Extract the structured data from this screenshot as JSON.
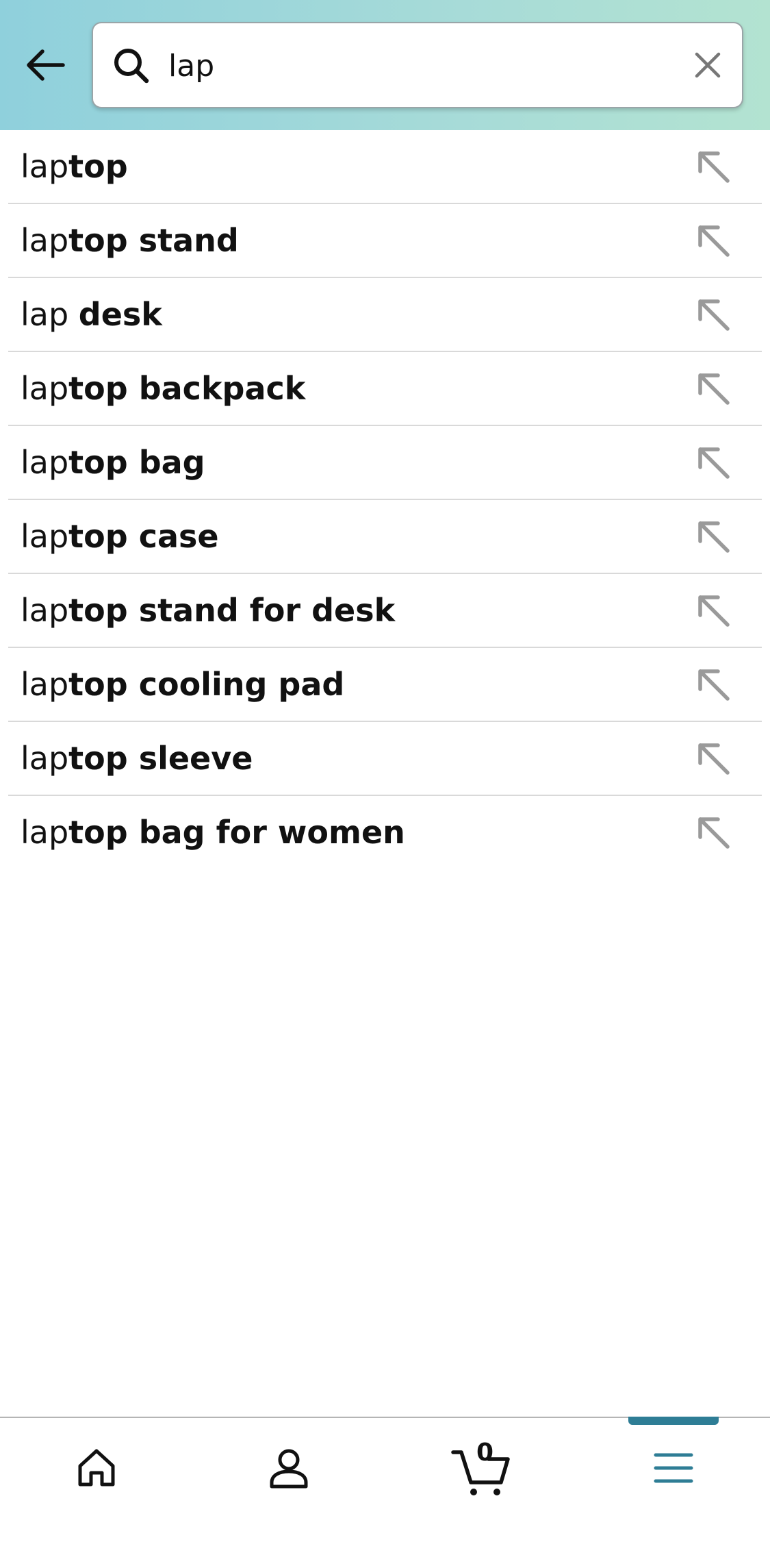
{
  "search": {
    "value": "lap",
    "placeholder": ""
  },
  "suggestions": [
    {
      "prefix": "lap",
      "completion": "top"
    },
    {
      "prefix": "lap",
      "completion": "top stand"
    },
    {
      "prefix": "lap ",
      "completion": "desk"
    },
    {
      "prefix": "lap",
      "completion": "top backpack"
    },
    {
      "prefix": "lap",
      "completion": "top bag"
    },
    {
      "prefix": "lap",
      "completion": "top case"
    },
    {
      "prefix": "lap",
      "completion": "top stand for desk"
    },
    {
      "prefix": "lap",
      "completion": "top cooling pad"
    },
    {
      "prefix": "lap",
      "completion": "top sleeve"
    },
    {
      "prefix": "lap",
      "completion": "top bag for women"
    }
  ],
  "bottom_nav": {
    "items": [
      {
        "icon": "home-icon"
      },
      {
        "icon": "account-icon"
      },
      {
        "icon": "cart-icon"
      },
      {
        "icon": "menu-icon"
      }
    ],
    "cart_count": "0",
    "active_index": 3
  },
  "colors": {
    "header_gradient_start": "#8fd0dc",
    "header_gradient_end": "#b3e3d1",
    "active_accent": "#2e7d95",
    "suggestion_arrow": "#9a9a9a",
    "divider": "#d9d9d9"
  }
}
